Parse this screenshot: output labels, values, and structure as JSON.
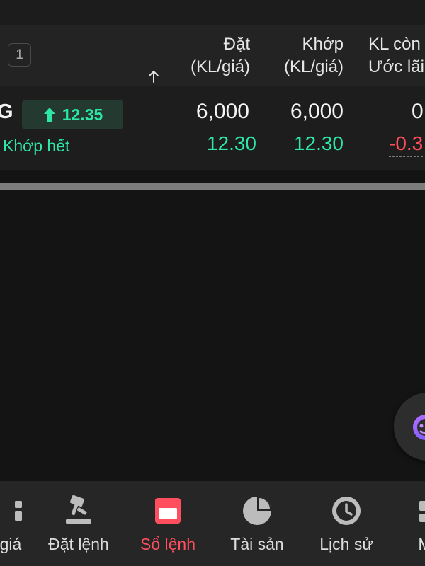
{
  "header": {
    "count_badge": "1",
    "columns": {
      "dat": {
        "line1": "Đặt",
        "line2": "(KL/giá)"
      },
      "khop": {
        "line1": "Khớp",
        "line2": "(KL/giá)"
      },
      "kl_con": {
        "line1": "KL còn",
        "line2": "Ước lãi"
      }
    },
    "sort_icon": "arrow-up-icon"
  },
  "order": {
    "ticker": "G",
    "price_change": "12.35",
    "price_direction_icon": "arrow-up-icon",
    "status": "Khớp hết",
    "dat_qty": "6,000",
    "dat_price": "12.30",
    "khop_qty": "6,000",
    "khop_price": "12.30",
    "kl_con": "0",
    "uoc_lai": "-0.3"
  },
  "bottom_nav": {
    "items": [
      {
        "label": "giá",
        "icon": "market-icon",
        "active": false
      },
      {
        "label": "Đặt lệnh",
        "icon": "gavel-icon",
        "active": false
      },
      {
        "label": "Sổ lệnh",
        "icon": "order-book-icon",
        "active": true
      },
      {
        "label": "Tài sản",
        "icon": "pie-chart-icon",
        "active": false
      },
      {
        "label": "Lịch sử",
        "icon": "clock-icon",
        "active": false
      },
      {
        "label": "M",
        "icon": "more-icon",
        "active": false
      }
    ]
  },
  "fab": {
    "icon": "assistant-icon"
  },
  "colors": {
    "background": "#141414",
    "header_bg": "#232323",
    "row_bg": "#1d1d1d",
    "positive": "#2ee6a6",
    "negative": "#ff4d5a",
    "active_tab": "#ff4f5e",
    "nav_bg": "#262626"
  }
}
